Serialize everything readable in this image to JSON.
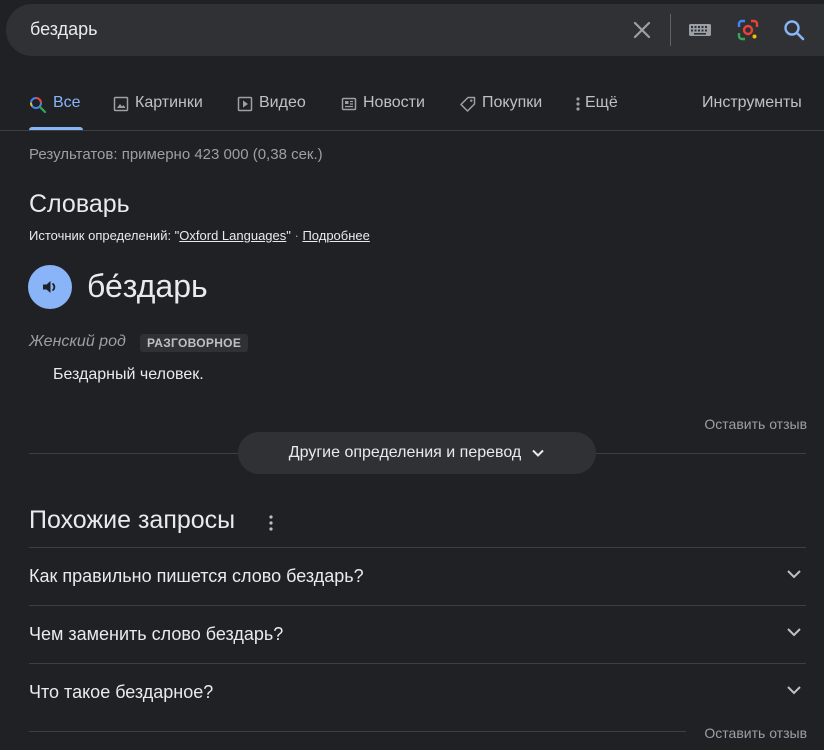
{
  "search": {
    "query": "бездарь",
    "clear_icon": "close-icon",
    "keyboard_icon": "keyboard-icon",
    "lens_icon": "google-lens-icon",
    "search_icon": "search-icon"
  },
  "tabs": [
    {
      "label": "Все",
      "icon": "search-icon",
      "active": true
    },
    {
      "label": "Картинки",
      "icon": "image-icon"
    },
    {
      "label": "Видео",
      "icon": "play-icon"
    },
    {
      "label": "Новости",
      "icon": "news-icon"
    },
    {
      "label": "Покупки",
      "icon": "tag-icon"
    },
    {
      "label": "Ещё",
      "icon": "more-vert-icon"
    }
  ],
  "tools_label": "Инструменты",
  "stats": "Результатов: примерно 423 000 (0,38 сек.) ",
  "dictionary": {
    "title": "Словарь",
    "source_prefix": "Источник определений: \"",
    "source_link": "Oxford Languages",
    "source_suffix": "\"",
    "separator": " · ",
    "more_link": "Подробнее",
    "word": "бе́здарь",
    "part_of_speech": "Женский род",
    "register": "РАЗГОВОРНОЕ",
    "definition": "Бездарный человек.",
    "feedback": "Оставить отзыв",
    "more_button": "Другие определения и перевод"
  },
  "related": {
    "title": "Похожие запросы",
    "items": [
      "Как правильно пишется слово бездарь?",
      "Чем заменить слово бездарь?",
      "Что такое бездарное?"
    ],
    "feedback": "Оставить отзыв"
  },
  "colors": {
    "background": "#202124",
    "accent": "#8ab4f8",
    "text": "#e8eaed",
    "muted": "#9aa0a6"
  }
}
